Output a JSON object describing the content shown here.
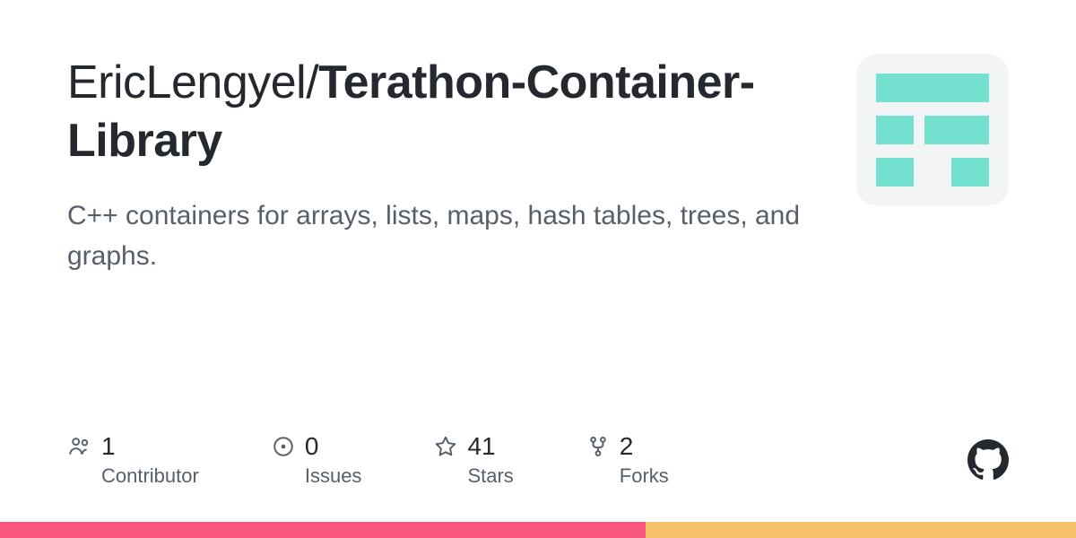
{
  "repo": {
    "owner": "EricLengyel",
    "separator": "/",
    "name_bold": "Terathon",
    "name_rest": "-Container-Library",
    "description": "C++ containers for arrays, lists, maps, hash tables, trees, and graphs."
  },
  "stats": {
    "contributors": {
      "count": "1",
      "label": "Contributor"
    },
    "issues": {
      "count": "0",
      "label": "Issues"
    },
    "stars": {
      "count": "41",
      "label": "Stars"
    },
    "forks": {
      "count": "2",
      "label": "Forks"
    }
  },
  "icons": {
    "contributors": "people-icon",
    "issues": "issue-icon",
    "stars": "star-icon",
    "forks": "fork-icon",
    "github": "github-icon",
    "repo": "repo-icon"
  },
  "colors": {
    "accent": "#74e0cf",
    "gradient_left": "#f9567d",
    "gradient_right": "#f6c36b"
  }
}
